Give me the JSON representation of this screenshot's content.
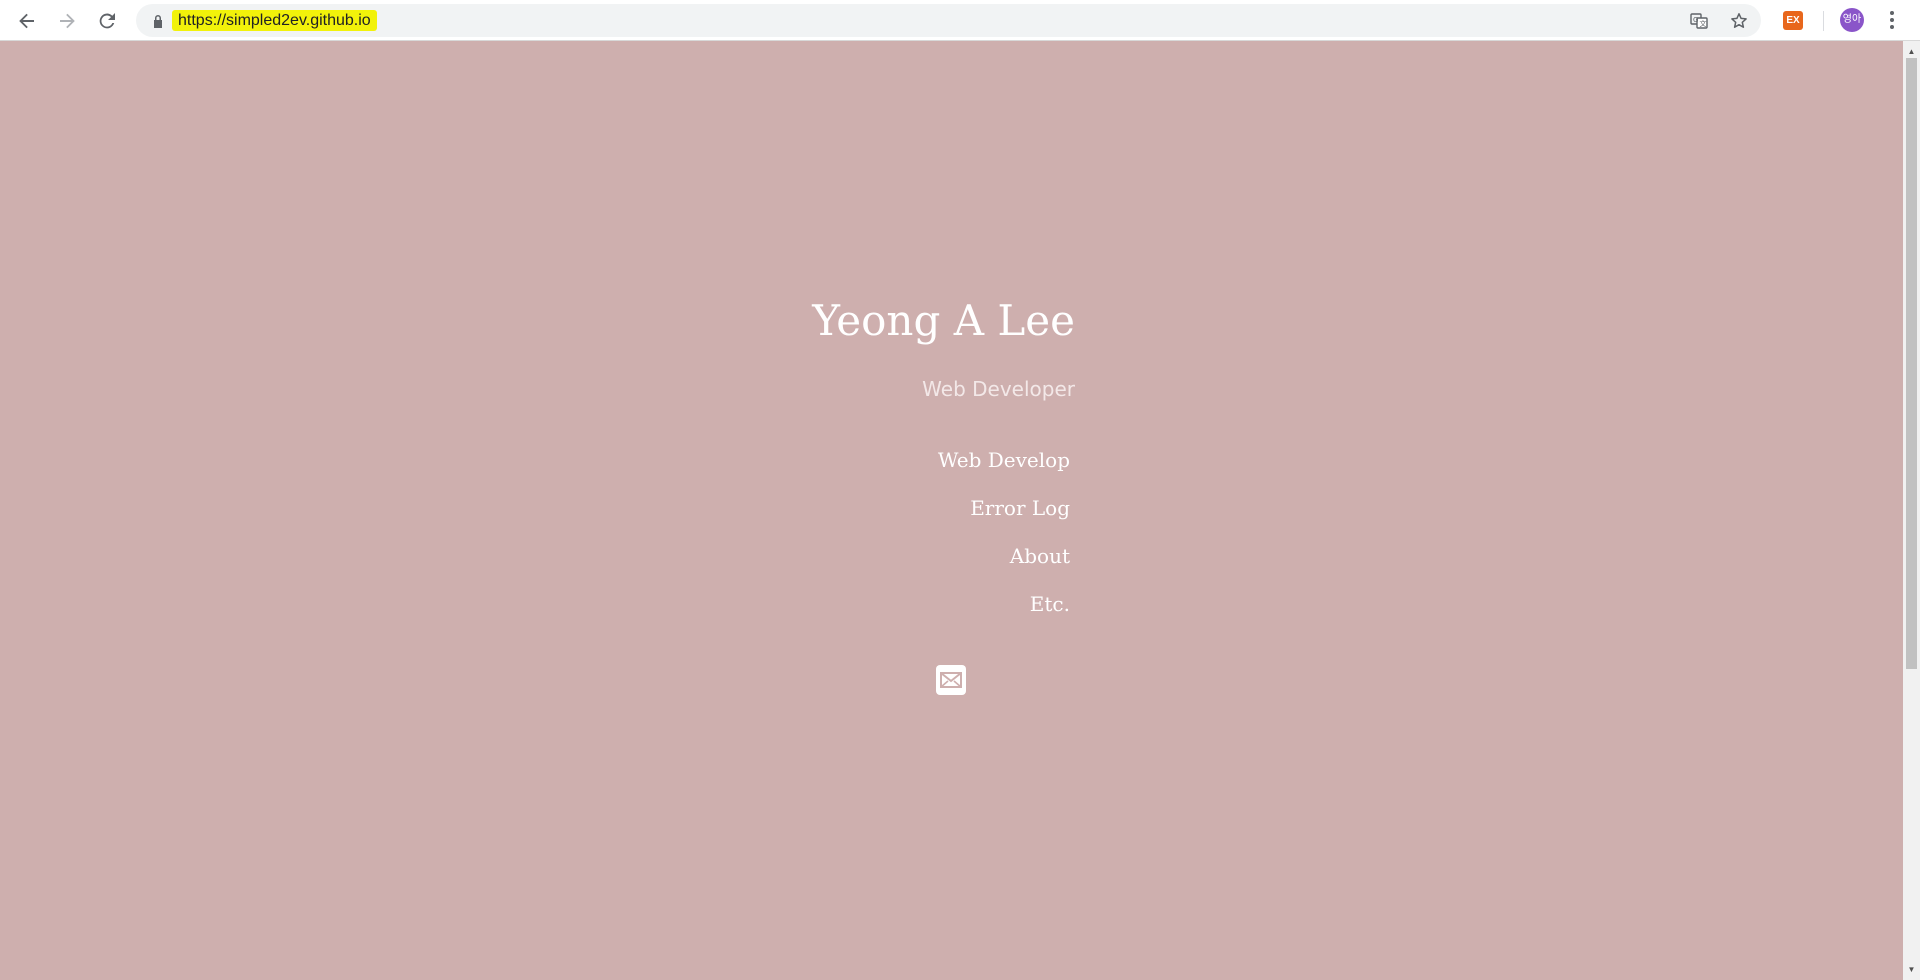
{
  "browser": {
    "url": "https://simpled2ev.github.io",
    "icons": {
      "back": "back-arrow-icon",
      "forward": "forward-arrow-icon",
      "reload": "reload-icon",
      "lock": "lock-icon",
      "translate": "translate-icon",
      "bookmark": "star-icon",
      "extension": "extension-icon",
      "menu": "more-vert-icon"
    },
    "extension_label": "EX",
    "profile_label": "영아"
  },
  "site": {
    "title": "Yeong A Lee",
    "subtitle": "Web Developer",
    "nav": [
      {
        "label": "Web Develop"
      },
      {
        "label": "Error Log"
      },
      {
        "label": "About"
      },
      {
        "label": "Etc."
      }
    ],
    "contact_icon": "mail-icon"
  },
  "colors": {
    "page_background": "#ceafae",
    "url_highlight": "#f2f20a",
    "text": "#ffffff",
    "avatar": "#8a55c9",
    "extension": "#e8671c"
  }
}
